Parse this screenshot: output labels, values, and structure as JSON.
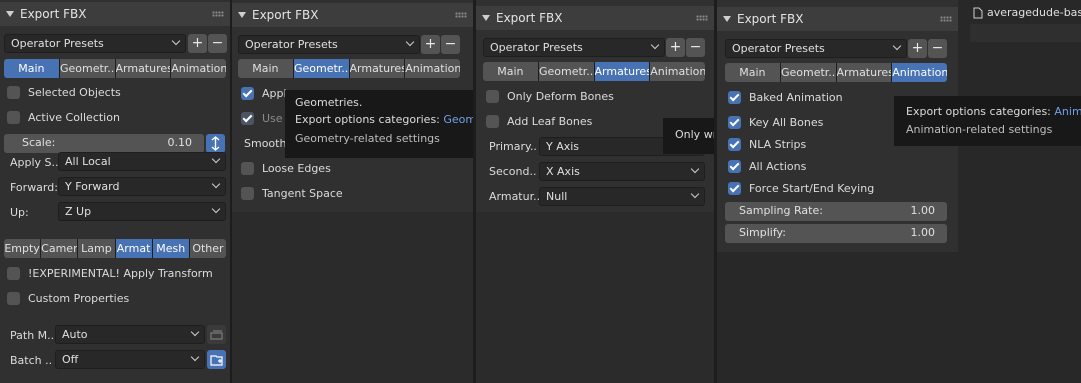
{
  "title": "Export FBX",
  "presets": "Operator Presets",
  "tabs": [
    "Main",
    "Geometr..",
    "Armatures",
    "Animation"
  ],
  "main": {
    "selected_objects": "Selected Objects",
    "active_collection": "Active Collection",
    "scale_label": "Scale:",
    "scale_value": "0.10",
    "apply_scale_label": "Apply S..",
    "apply_scale_value": "All Local",
    "forward_label": "Forward:",
    "forward_value": "Y Forward",
    "up_label": "Up:",
    "up_value": "Z Up",
    "object_types": [
      "Empty",
      "Camer",
      "Lamp",
      "Armat",
      "Mesh",
      "Other"
    ],
    "apply_transform": "!EXPERIMENTAL! Apply Transform",
    "custom_properties": "Custom Properties",
    "path_mode_label": "Path M..",
    "path_mode_value": "Auto",
    "batch_label": "Batch ..",
    "batch_value": "Off"
  },
  "geometry": {
    "apply_modifiers": "Apply Modifiers",
    "use_modifiers_render": "Use Modifiers Render Setting",
    "smoothing_label": "Smoothing",
    "loose_edges": "Loose Edges",
    "tangent_space": "Tangent Space",
    "tooltip_title": "Geometries.",
    "tooltip_line_prefix": "Export options categories: ",
    "tooltip_line_value": "Geometry",
    "tooltip_desc": "Geometry-related settings"
  },
  "armatures": {
    "only_deform_bones": "Only Deform Bones",
    "add_leaf_bones": "Add Leaf Bones",
    "primary_label": "Primary..",
    "primary_value": "Y Axis",
    "secondary_label": "Second..",
    "secondary_value": "X Axis",
    "armature_label": "Armatur..",
    "armature_value": "Null",
    "tooltip_text": "Only write deforming bones"
  },
  "animation": {
    "baked_animation": "Baked Animation",
    "key_all_bones": "Key All Bones",
    "nla_strips": "NLA Strips",
    "all_actions": "All Actions",
    "force_keying": "Force Start/End Keying",
    "sampling_label": "Sampling Rate:",
    "sampling_value": "1.00",
    "simplify_label": "Simplify:",
    "simplify_value": "1.00",
    "tooltip_line_prefix": "Export options categories: ",
    "tooltip_line_value": "Animation",
    "tooltip_desc": "Animation-related settings"
  },
  "file_browser": {
    "file_name": "averagedude-base-"
  },
  "colors": {
    "accent": "#4772b3",
    "panel": "#303030",
    "header": "#3d3d3d"
  }
}
